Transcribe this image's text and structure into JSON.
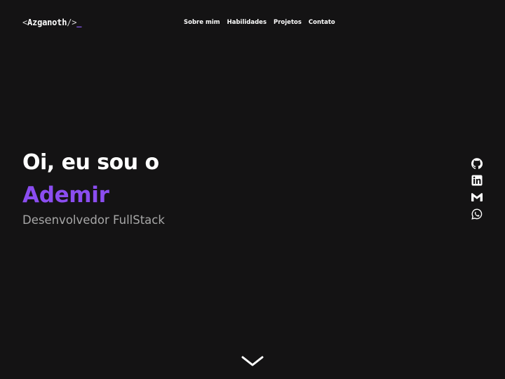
{
  "header": {
    "logo": {
      "open_bracket": "<",
      "name": "Azganoth",
      "close_bracket": "/>",
      "cursor": "_"
    },
    "nav": [
      {
        "label": "Sobre mim"
      },
      {
        "label": "Habilidades"
      },
      {
        "label": "Projetos"
      },
      {
        "label": "Contato"
      }
    ]
  },
  "hero": {
    "greeting": "Oi, eu sou o",
    "name": "Ademir",
    "role": "Desenvolvedor FullStack"
  },
  "social": [
    {
      "icon": "github-icon"
    },
    {
      "icon": "linkedin-icon"
    },
    {
      "icon": "gmail-icon"
    },
    {
      "icon": "whatsapp-icon"
    }
  ],
  "scroll": {
    "icon": "chevron-down-icon"
  },
  "colors": {
    "background": "#141314",
    "accent": "#8b4df0",
    "text": "#ffffff",
    "muted": "#a7a7a7"
  }
}
